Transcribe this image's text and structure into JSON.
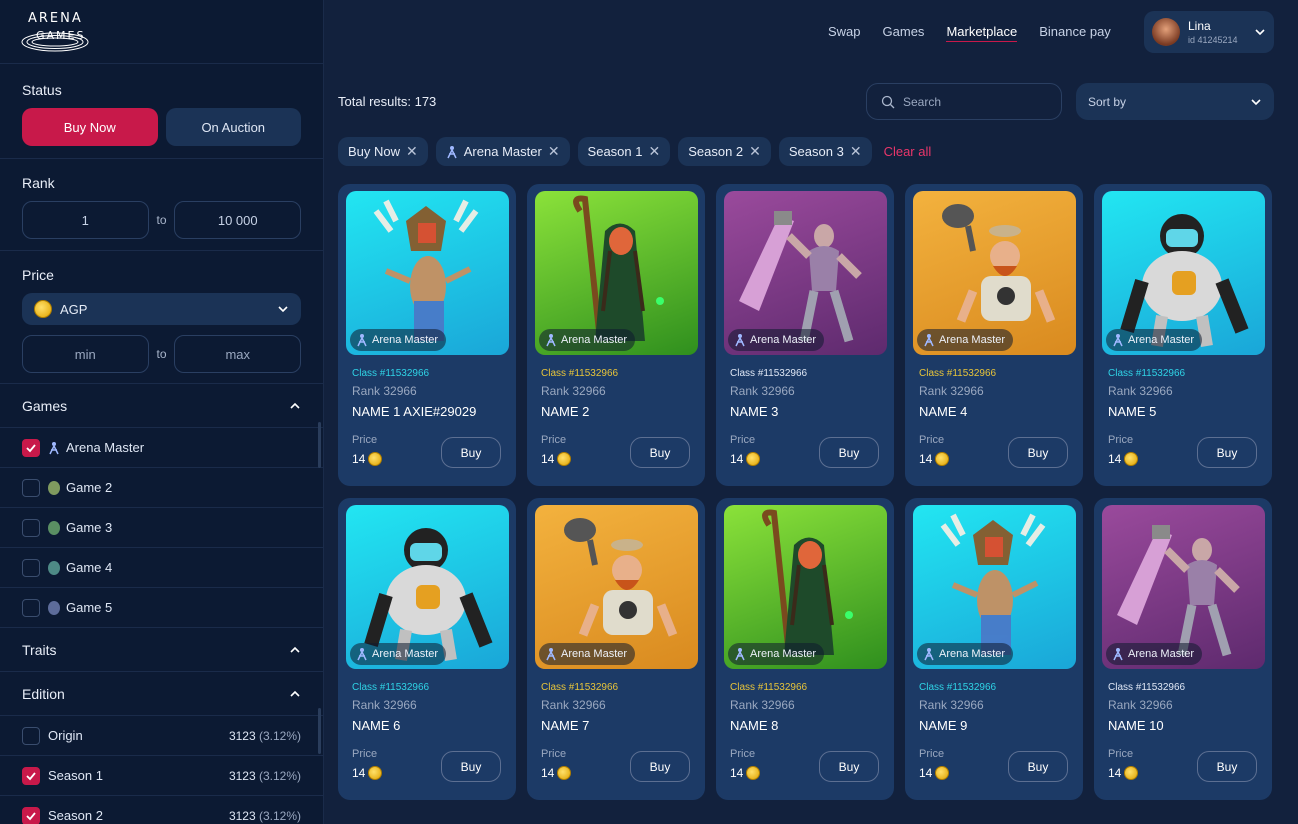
{
  "logo": {
    "line1": "ARENA",
    "line2": "GAMES"
  },
  "filters": {
    "status": {
      "title": "Status",
      "buy_now": "Buy Now",
      "on_auction": "On Auction"
    },
    "rank": {
      "title": "Rank",
      "min": "1",
      "to": "to",
      "max": "10 000"
    },
    "price": {
      "title": "Price",
      "currency": "AGP",
      "min_placeholder": "min",
      "to": "to",
      "max_placeholder": "max"
    },
    "games": {
      "title": "Games",
      "items": [
        {
          "label": "Arena Master",
          "checked": true
        },
        {
          "label": "Game 2",
          "checked": false,
          "color": "#7f9a5f"
        },
        {
          "label": "Game 3",
          "checked": false,
          "color": "#5a8f63"
        },
        {
          "label": "Game 4",
          "checked": false,
          "color": "#4e8a86"
        },
        {
          "label": "Game 5",
          "checked": false,
          "color": "#5d6c9a"
        }
      ]
    },
    "traits": {
      "title": "Traits"
    },
    "edition": {
      "title": "Edition",
      "items": [
        {
          "label": "Origin",
          "count": "3123",
          "pct": "(3.12%)",
          "checked": false
        },
        {
          "label": "Season 1",
          "count": "3123",
          "pct": "(3.12%)",
          "checked": true
        },
        {
          "label": "Season 2",
          "count": "3123",
          "pct": "(3.12%)",
          "checked": true
        }
      ]
    }
  },
  "nav": {
    "swap": "Swap",
    "games": "Games",
    "marketplace": "Marketplace",
    "binance": "Binance pay"
  },
  "user": {
    "name": "Lina",
    "id": "id 41245214"
  },
  "toolbar": {
    "total": "Total results: 173",
    "search_placeholder": "Search",
    "sort": "Sort by"
  },
  "chips": [
    "Buy Now",
    "Arena Master",
    "Season 1",
    "Season 2",
    "Season 3"
  ],
  "clear_all": "Clear all",
  "cards": [
    {
      "name": "NAME 1 AXIE#29029",
      "class": "Class #11532966",
      "rank": "Rank 32966",
      "price": "14",
      "game": "Arena Master",
      "bg": "cyan",
      "hero": "shaman"
    },
    {
      "name": "NAME 2",
      "class": "Class #11532966",
      "rank": "Rank 32966",
      "price": "14",
      "game": "Arena Master",
      "bg": "green",
      "hero": "witch"
    },
    {
      "name": "NAME 3",
      "class": "Class #11532966",
      "rank": "Rank 32966",
      "price": "14",
      "game": "Arena Master",
      "bg": "purple",
      "hero": "warrior"
    },
    {
      "name": "NAME 4",
      "class": "Class #11532966",
      "rank": "Rank 32966",
      "price": "14",
      "game": "Arena Master",
      "bg": "orange",
      "hero": "dwarf"
    },
    {
      "name": "NAME 5",
      "class": "Class #11532966",
      "rank": "Rank 32966",
      "price": "14",
      "game": "Arena Master",
      "bg": "cyan",
      "hero": "gorilla"
    },
    {
      "name": "NAME 6",
      "class": "Class #11532966",
      "rank": "Rank 32966",
      "price": "14",
      "game": "Arena Master",
      "bg": "cyan",
      "hero": "gorilla"
    },
    {
      "name": "NAME 7",
      "class": "Class #11532966",
      "rank": "Rank 32966",
      "price": "14",
      "game": "Arena Master",
      "bg": "orange",
      "hero": "dwarf"
    },
    {
      "name": "NAME 8",
      "class": "Class #11532966",
      "rank": "Rank 32966",
      "price": "14",
      "game": "Arena Master",
      "bg": "green",
      "hero": "witch"
    },
    {
      "name": "NAME 9",
      "class": "Class #11532966",
      "rank": "Rank 32966",
      "price": "14",
      "game": "Arena Master",
      "bg": "cyan",
      "hero": "shaman"
    },
    {
      "name": "NAME 10",
      "class": "Class #11532966",
      "rank": "Rank 32966",
      "price": "14",
      "game": "Arena Master",
      "bg": "purple",
      "hero": "warrior"
    }
  ],
  "labels": {
    "price": "Price",
    "buy": "Buy"
  },
  "colors": {
    "accent": "#c8194a",
    "class_cyan": "#2fd3e6",
    "class_gold": "#e7c43a",
    "class_green": "#7ed957",
    "class_white": "#dfe7f5"
  }
}
